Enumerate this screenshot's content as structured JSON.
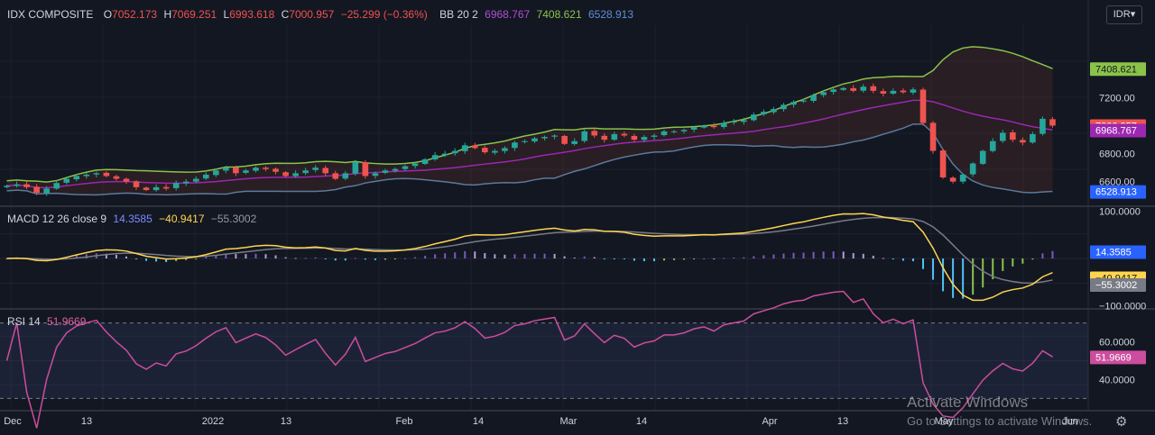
{
  "header": {
    "symbol": "IDX COMPOSITE",
    "ohlc": [
      {
        "key": "O",
        "value": "7052.173"
      },
      {
        "key": "H",
        "value": "7069.251"
      },
      {
        "key": "L",
        "value": "6993.618"
      },
      {
        "key": "C",
        "value": "7000.957"
      }
    ],
    "change": "−25.299 (−0.36%)",
    "bb_label": "BB 20 2",
    "bb_values": [
      "6968.767",
      "7408.621",
      "6528.913"
    ],
    "currency_button": "IDR"
  },
  "macd_legend": {
    "label": "MACD 12 26 close 9",
    "values": [
      "14.3585",
      "−40.9417",
      "−55.3002"
    ]
  },
  "rsi_legend": {
    "label": "RSI 14",
    "value": "51.9669"
  },
  "watermark": {
    "title": "Activate Windows",
    "subtitle": "Go to Settings to activate Windows."
  },
  "colors": {
    "bg": "#131722",
    "up": "#26a69a",
    "down": "#ef5350",
    "bb_upper": "#8bc34a",
    "bb_mid": "#9c27b0",
    "bb_lower": "#5b7a9c",
    "macd": "#ffd54f",
    "signal": "#787b86",
    "hist_pos": "#7e57c2",
    "hist_neg": "#4fc3f7",
    "rsi": "#cc4d9e"
  },
  "chart_data": [
    {
      "type": "candlestick",
      "name": "price",
      "x_tick_labels": [
        "Dec",
        "13",
        "2022",
        "13",
        "Feb",
        "14",
        "Mar",
        "14",
        "Apr",
        "13",
        "May",
        "Jun"
      ],
      "y_ticks": [
        6600,
        6800,
        7000,
        7200,
        7400
      ],
      "ylim": [
        6430,
        7720
      ],
      "price_labels": [
        {
          "value": 7408.621,
          "text": "7408.621",
          "color": "#8bc34a"
        },
        {
          "value": 7000.957,
          "text": "7000.957",
          "color": "#ef5350"
        },
        {
          "value": 6968.767,
          "text": "6968.767",
          "color": "#9c27b0"
        },
        {
          "value": 6528.913,
          "text": "6528.913",
          "color": "#2962ff"
        }
      ],
      "close": [
        6570,
        6580,
        6560,
        6520,
        6550,
        6590,
        6620,
        6640,
        6650,
        6660,
        6640,
        6620,
        6600,
        6560,
        6540,
        6560,
        6550,
        6590,
        6600,
        6620,
        6650,
        6680,
        6700,
        6660,
        6680,
        6700,
        6690,
        6670,
        6640,
        6660,
        6680,
        6700,
        6660,
        6620,
        6660,
        6740,
        6640,
        6660,
        6680,
        6690,
        6710,
        6730,
        6760,
        6790,
        6800,
        6820,
        6860,
        6840,
        6810,
        6820,
        6840,
        6880,
        6890,
        6910,
        6920,
        6930,
        6870,
        6890,
        6960,
        6930,
        6900,
        6940,
        6930,
        6900,
        6920,
        6930,
        6960,
        6960,
        6970,
        6990,
        7000,
        6990,
        7020,
        7030,
        7040,
        7080,
        7100,
        7120,
        7150,
        7170,
        7180,
        7220,
        7240,
        7260,
        7270,
        7250,
        7280,
        7250,
        7230,
        7250,
        7240,
        7260,
        7020,
        6820,
        6630,
        6600,
        6650,
        6730,
        6820,
        6890,
        6950,
        6900,
        6880,
        6940,
        7050,
        7001
      ]
    },
    {
      "type": "line",
      "name": "MACD",
      "y_ticks": [
        100,
        -100
      ],
      "y_tick_labels": [
        "100.0000",
        "−100.0000"
      ],
      "ylim": [
        -105,
        105
      ],
      "value_labels": [
        {
          "value": 14.3585,
          "text": "14.3585",
          "color": "#2962ff"
        },
        {
          "value": -40.9417,
          "text": "−40.9417",
          "color": "#ffd54f"
        },
        {
          "value": -55.3002,
          "text": "−55.3002",
          "color": "#787b86"
        }
      ]
    },
    {
      "type": "line",
      "name": "RSI",
      "y_ticks": [
        60,
        40
      ],
      "y_tick_labels": [
        "60.0000",
        "40.0000"
      ],
      "band": [
        30,
        70
      ],
      "ylim": [
        24,
        76
      ],
      "value_labels": [
        {
          "value": 51.9669,
          "text": "51.9669",
          "color": "#cc4d9e"
        }
      ]
    }
  ]
}
